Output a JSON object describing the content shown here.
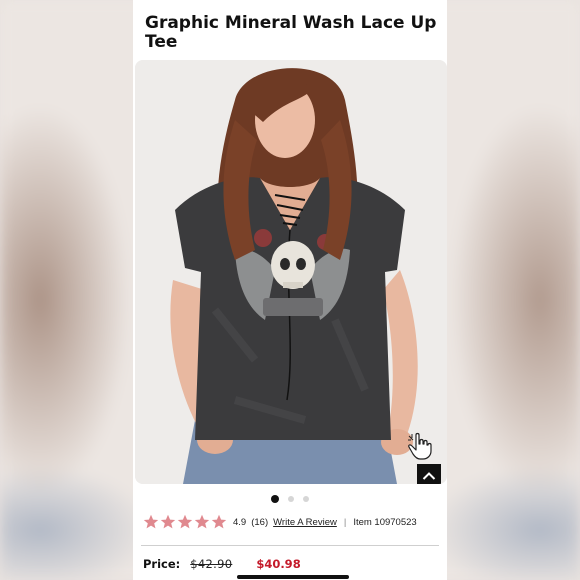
{
  "product": {
    "title": "Graphic Mineral Wash Lace Up Tee",
    "rating": "4.9",
    "review_count": "(16)",
    "rating_stars": 5,
    "review_link": "Write A Review",
    "separator": "|",
    "item_number": "Item 10970523"
  },
  "gallery": {
    "image_count": 3,
    "active_index": 0
  },
  "pricing": {
    "label": "Price:",
    "original": "$42.90",
    "sale": "$40.98"
  },
  "colors": {
    "star": "#e0898f",
    "sale_price": "#c41a2a",
    "text": "#111111"
  },
  "icons": {
    "zoom": "pointing-hand-icon",
    "scroll_top": "chevron-up-icon",
    "star": "star-icon"
  }
}
